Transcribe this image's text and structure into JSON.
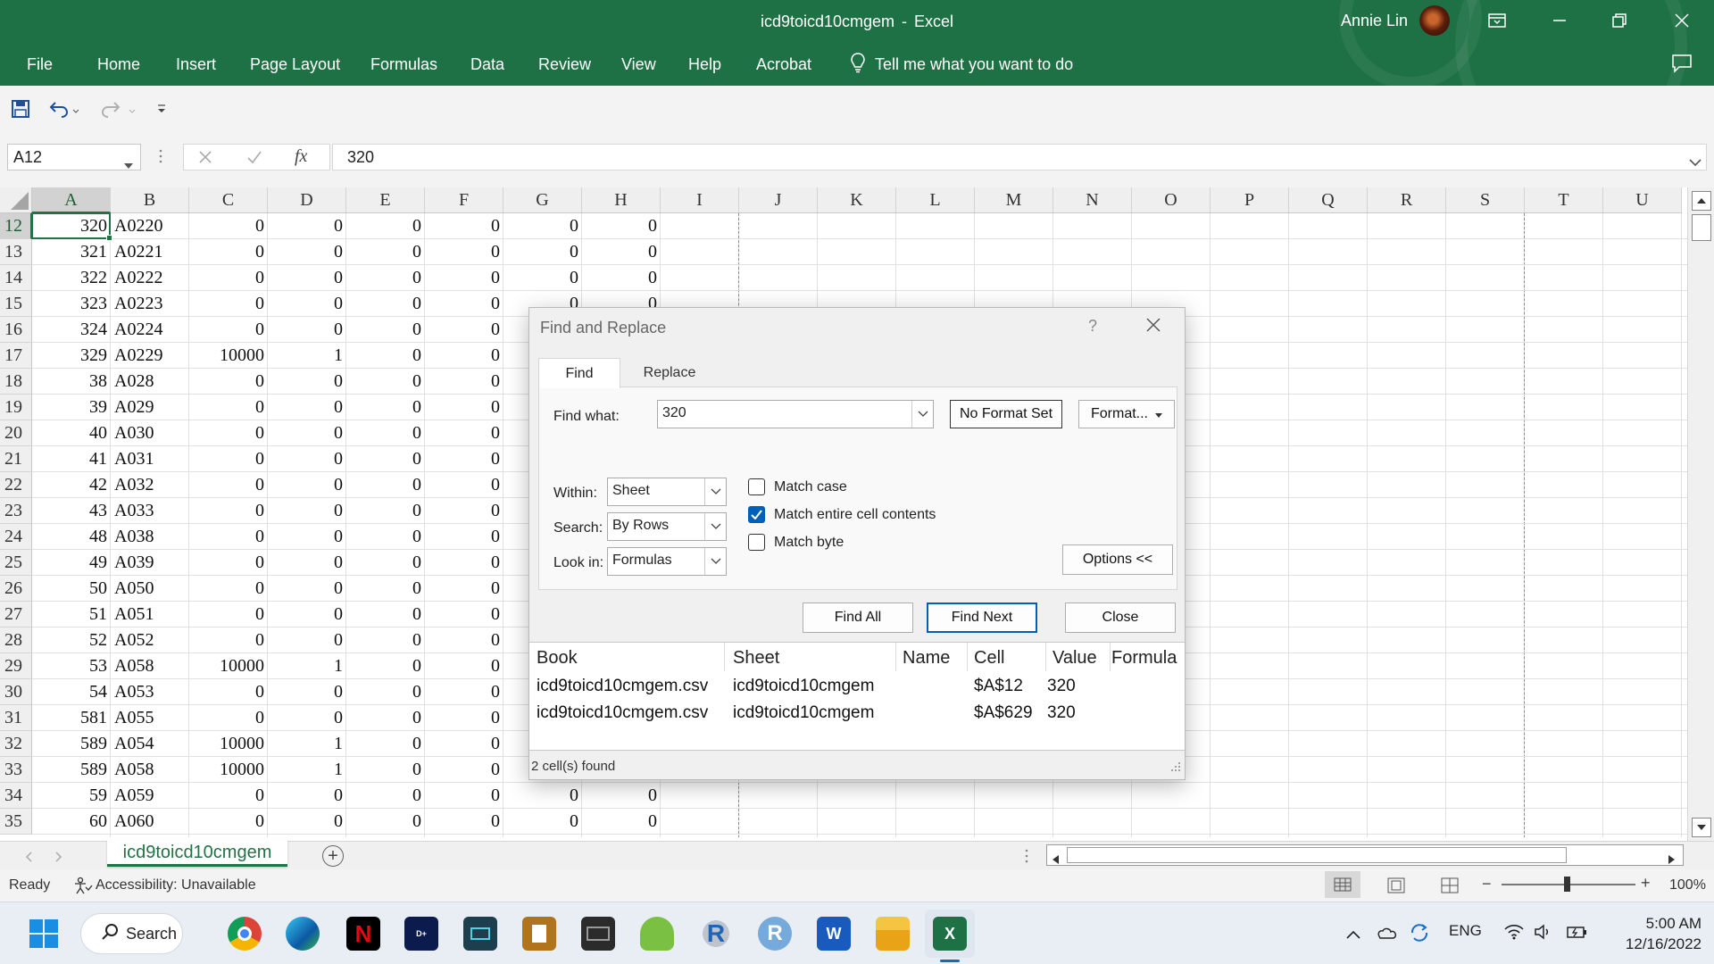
{
  "window": {
    "filename": "icd9toicd10cmgem",
    "separator": "-",
    "app": "Excel",
    "user": "Annie Lin"
  },
  "menu": [
    "File",
    "Home",
    "Insert",
    "Page Layout",
    "Formulas",
    "Data",
    "Review",
    "View",
    "Help",
    "Acrobat"
  ],
  "tell_me": "Tell me what you want to do",
  "formula_bar": {
    "name_box": "A12",
    "fx": "fx",
    "value": "320"
  },
  "columns": [
    "A",
    "B",
    "C",
    "D",
    "E",
    "F",
    "G",
    "H",
    "I",
    "J",
    "K",
    "L",
    "M",
    "N",
    "O",
    "P",
    "Q",
    "R",
    "S",
    "T",
    "U"
  ],
  "rows": [
    {
      "n": "12",
      "cells": [
        "320",
        "A0220",
        "0",
        "0",
        "0",
        "0",
        "0",
        "0"
      ]
    },
    {
      "n": "13",
      "cells": [
        "321",
        "A0221",
        "0",
        "0",
        "0",
        "0",
        "0",
        "0"
      ]
    },
    {
      "n": "14",
      "cells": [
        "322",
        "A0222",
        "0",
        "0",
        "0",
        "0",
        "0",
        "0"
      ]
    },
    {
      "n": "15",
      "cells": [
        "323",
        "A0223",
        "0",
        "0",
        "0",
        "0",
        "0",
        "0"
      ]
    },
    {
      "n": "16",
      "cells": [
        "324",
        "A0224",
        "0",
        "0",
        "0",
        "0",
        "",
        ""
      ]
    },
    {
      "n": "17",
      "cells": [
        "329",
        "A0229",
        "10000",
        "1",
        "0",
        "0",
        "",
        ""
      ]
    },
    {
      "n": "18",
      "cells": [
        "38",
        "A028",
        "0",
        "0",
        "0",
        "0",
        "",
        ""
      ]
    },
    {
      "n": "19",
      "cells": [
        "39",
        "A029",
        "0",
        "0",
        "0",
        "0",
        "",
        ""
      ]
    },
    {
      "n": "20",
      "cells": [
        "40",
        "A030",
        "0",
        "0",
        "0",
        "0",
        "",
        ""
      ]
    },
    {
      "n": "21",
      "cells": [
        "41",
        "A031",
        "0",
        "0",
        "0",
        "0",
        "",
        ""
      ]
    },
    {
      "n": "22",
      "cells": [
        "42",
        "A032",
        "0",
        "0",
        "0",
        "0",
        "",
        ""
      ]
    },
    {
      "n": "23",
      "cells": [
        "43",
        "A033",
        "0",
        "0",
        "0",
        "0",
        "",
        ""
      ]
    },
    {
      "n": "24",
      "cells": [
        "48",
        "A038",
        "0",
        "0",
        "0",
        "0",
        "",
        ""
      ]
    },
    {
      "n": "25",
      "cells": [
        "49",
        "A039",
        "0",
        "0",
        "0",
        "0",
        "",
        ""
      ]
    },
    {
      "n": "26",
      "cells": [
        "50",
        "A050",
        "0",
        "0",
        "0",
        "0",
        "",
        ""
      ]
    },
    {
      "n": "27",
      "cells": [
        "51",
        "A051",
        "0",
        "0",
        "0",
        "0",
        "",
        ""
      ]
    },
    {
      "n": "28",
      "cells": [
        "52",
        "A052",
        "0",
        "0",
        "0",
        "0",
        "",
        ""
      ]
    },
    {
      "n": "29",
      "cells": [
        "53",
        "A058",
        "10000",
        "1",
        "0",
        "0",
        "",
        ""
      ]
    },
    {
      "n": "30",
      "cells": [
        "54",
        "A053",
        "0",
        "0",
        "0",
        "0",
        "",
        ""
      ]
    },
    {
      "n": "31",
      "cells": [
        "581",
        "A055",
        "0",
        "0",
        "0",
        "0",
        "",
        ""
      ]
    },
    {
      "n": "32",
      "cells": [
        "589",
        "A054",
        "10000",
        "1",
        "0",
        "0",
        "",
        ""
      ]
    },
    {
      "n": "33",
      "cells": [
        "589",
        "A058",
        "10000",
        "1",
        "0",
        "0",
        "",
        ""
      ]
    },
    {
      "n": "34",
      "cells": [
        "59",
        "A059",
        "0",
        "0",
        "0",
        "0",
        "0",
        "0"
      ]
    },
    {
      "n": "35",
      "cells": [
        "60",
        "A060",
        "0",
        "0",
        "0",
        "0",
        "0",
        "0"
      ]
    }
  ],
  "sheet_tab": "icd9toicd10cmgem",
  "status": {
    "ready": "Ready",
    "accessibility": "Accessibility: Unavailable",
    "zoom": "100%"
  },
  "dialog": {
    "title": "Find and Replace",
    "help": "?",
    "tabs": {
      "find": "Find",
      "replace": "Replace"
    },
    "find_what_label": "Find what:",
    "find_what_value": "320",
    "no_format": "No Format Set",
    "format_btn": "Format...",
    "within_label": "Within:",
    "within_value": "Sheet",
    "search_label": "Search:",
    "search_value": "By Rows",
    "lookin_label": "Look in:",
    "lookin_value": "Formulas",
    "match_case": "Match case",
    "match_case_checked": false,
    "match_entire": "Match entire cell contents",
    "match_entire_checked": true,
    "match_byte": "Match byte",
    "match_byte_checked": false,
    "options_btn": "Options <<",
    "find_all": "Find All",
    "find_next": "Find Next",
    "close": "Close",
    "results_headers": [
      "Book",
      "Sheet",
      "Name",
      "Cell",
      "Value",
      "Formula"
    ],
    "results": [
      {
        "book": "icd9toicd10cmgem.csv",
        "sheet": "icd9toicd10cmgem",
        "name": "",
        "cell": "$A$12",
        "value": "320",
        "formula": ""
      },
      {
        "book": "icd9toicd10cmgem.csv",
        "sheet": "icd9toicd10cmgem",
        "name": "",
        "cell": "$A$629",
        "value": "320",
        "formula": ""
      }
    ],
    "found": "2 cell(s) found"
  },
  "taskbar": {
    "search": "Search",
    "lang": "ENG",
    "time": "5:00 AM",
    "date": "12/16/2022"
  },
  "colors": {
    "excel_green": "#1e7145",
    "selection": "#217346",
    "dialog_bg": "#f0f0f0",
    "checkbox_accent": "#005fb8"
  }
}
